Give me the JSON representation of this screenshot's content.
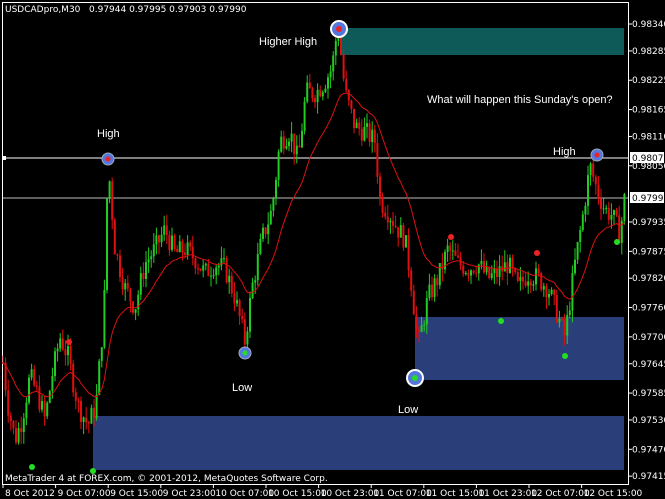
{
  "header": {
    "symbol_timeframe": "USDCADpro,M30",
    "ohlc": "0.97944 0.97995 0.97903 0.97990"
  },
  "footer": {
    "copyright": "MetaTrader 4 at FOREX.com, © 2001-2012, MetaQuotes Software Corp."
  },
  "annotations": {
    "high_left": "High",
    "higher_high": "Higher High",
    "high_right": "High",
    "low_left": "Low",
    "low_mid": "Low",
    "question": "What will happen this Sunday's open?"
  },
  "price_labels": {
    "high_line": "0.98072",
    "current": "0.97990"
  },
  "colors": {
    "background": "#000000",
    "bull_candle": "#22cc22",
    "bear_candle": "#e01010",
    "moving_average": "#dd1111",
    "supply_zone": "#0e5a58",
    "demand_zone": "#2a3f7a",
    "level_line": "#ffffff",
    "pivot_marker": "#5577dd",
    "swing_dot_green": "#22dd22",
    "swing_dot_red": "#ee2222"
  },
  "chart_data": {
    "type": "candlestick",
    "symbol": "USDCADpro",
    "timeframe": "M30",
    "yticks": [
      "0.98340",
      "0.98285",
      "0.98225",
      "0.98165",
      "0.98110",
      "0.98050",
      "0.97935",
      "0.97875",
      "0.97820",
      "0.97760",
      "0.97700",
      "0.97645",
      "0.97585",
      "0.97530",
      "0.97470",
      "0.97415"
    ],
    "ylim": [
      0.97399,
      0.98383
    ],
    "xticks": [
      "8 Oct 2012",
      "9 Oct 07:00",
      "9 Oct 15:00",
      "9 Oct 23:00",
      "10 Oct 07:00",
      "10 Oct 15:00",
      "10 Oct 23:00",
      "11 Oct 07:00",
      "11 Oct 15:00",
      "11 Oct 23:00",
      "12 Oct 07:00",
      "12 Oct 15:00"
    ],
    "horizontal_levels": [
      0.98072,
      0.9799
    ],
    "zones": [
      {
        "type": "supply",
        "price_from": 0.98283,
        "price_to": 0.98335
      },
      {
        "type": "demand",
        "price_from": 0.97651,
        "price_to": 0.97753
      },
      {
        "type": "demand",
        "price_from": 0.97456,
        "price_to": 0.97541
      }
    ],
    "swing_points": [
      {
        "label": "High",
        "time": "9 Oct 07:00",
        "price": 0.98072
      },
      {
        "label": "Higher High",
        "time": "10 Oct 23:00",
        "price": 0.98345
      },
      {
        "label": "High",
        "time": "12 Oct 15:00",
        "price": 0.98075
      },
      {
        "label": "Low",
        "time": "10 Oct 07:00",
        "price": 0.97687
      },
      {
        "label": "Low",
        "time": "11 Oct 15:00",
        "price": 0.97645
      }
    ],
    "price_path": [
      [
        0,
        0.977
      ],
      [
        8,
        0.9756
      ],
      [
        15,
        0.9749
      ],
      [
        22,
        0.9753
      ],
      [
        30,
        0.9762
      ],
      [
        38,
        0.9758
      ],
      [
        45,
        0.9753
      ],
      [
        52,
        0.9762
      ],
      [
        60,
        0.977
      ],
      [
        68,
        0.9766
      ],
      [
        78,
        0.9756
      ],
      [
        88,
        0.9752
      ],
      [
        96,
        0.9756
      ],
      [
        104,
        0.9775
      ],
      [
        108,
        0.9806
      ],
      [
        115,
        0.9788
      ],
      [
        125,
        0.978
      ],
      [
        135,
        0.9776
      ],
      [
        145,
        0.9785
      ],
      [
        155,
        0.9788
      ],
      [
        165,
        0.9792
      ],
      [
        175,
        0.9787
      ],
      [
        185,
        0.9788
      ],
      [
        195,
        0.9786
      ],
      [
        205,
        0.9783
      ],
      [
        215,
        0.9785
      ],
      [
        225,
        0.9784
      ],
      [
        235,
        0.9778
      ],
      [
        245,
        0.9769
      ],
      [
        252,
        0.978
      ],
      [
        262,
        0.979
      ],
      [
        272,
        0.9796
      ],
      [
        280,
        0.981
      ],
      [
        290,
        0.9812
      ],
      [
        298,
        0.9806
      ],
      [
        306,
        0.982
      ],
      [
        316,
        0.982
      ],
      [
        324,
        0.9822
      ],
      [
        332,
        0.9825
      ],
      [
        338,
        0.9834
      ],
      [
        345,
        0.982
      ],
      [
        355,
        0.9813
      ],
      [
        365,
        0.9812
      ],
      [
        375,
        0.981
      ],
      [
        380,
        0.9798
      ],
      [
        390,
        0.9795
      ],
      [
        398,
        0.9792
      ],
      [
        405,
        0.979
      ],
      [
        412,
        0.978
      ],
      [
        418,
        0.9768
      ],
      [
        428,
        0.9778
      ],
      [
        438,
        0.9782
      ],
      [
        448,
        0.9788
      ],
      [
        458,
        0.9785
      ],
      [
        468,
        0.9784
      ],
      [
        478,
        0.9785
      ],
      [
        488,
        0.9782
      ],
      [
        498,
        0.9783
      ],
      [
        508,
        0.9785
      ],
      [
        518,
        0.978
      ],
      [
        528,
        0.9783
      ],
      [
        538,
        0.9782
      ],
      [
        548,
        0.978
      ],
      [
        555,
        0.9776
      ],
      [
        565,
        0.977
      ],
      [
        575,
        0.9785
      ],
      [
        583,
        0.9795
      ],
      [
        590,
        0.9805
      ],
      [
        597,
        0.98
      ],
      [
        605,
        0.9796
      ],
      [
        612,
        0.9795
      ],
      [
        620,
        0.9791
      ],
      [
        625,
        0.9799
      ]
    ]
  }
}
